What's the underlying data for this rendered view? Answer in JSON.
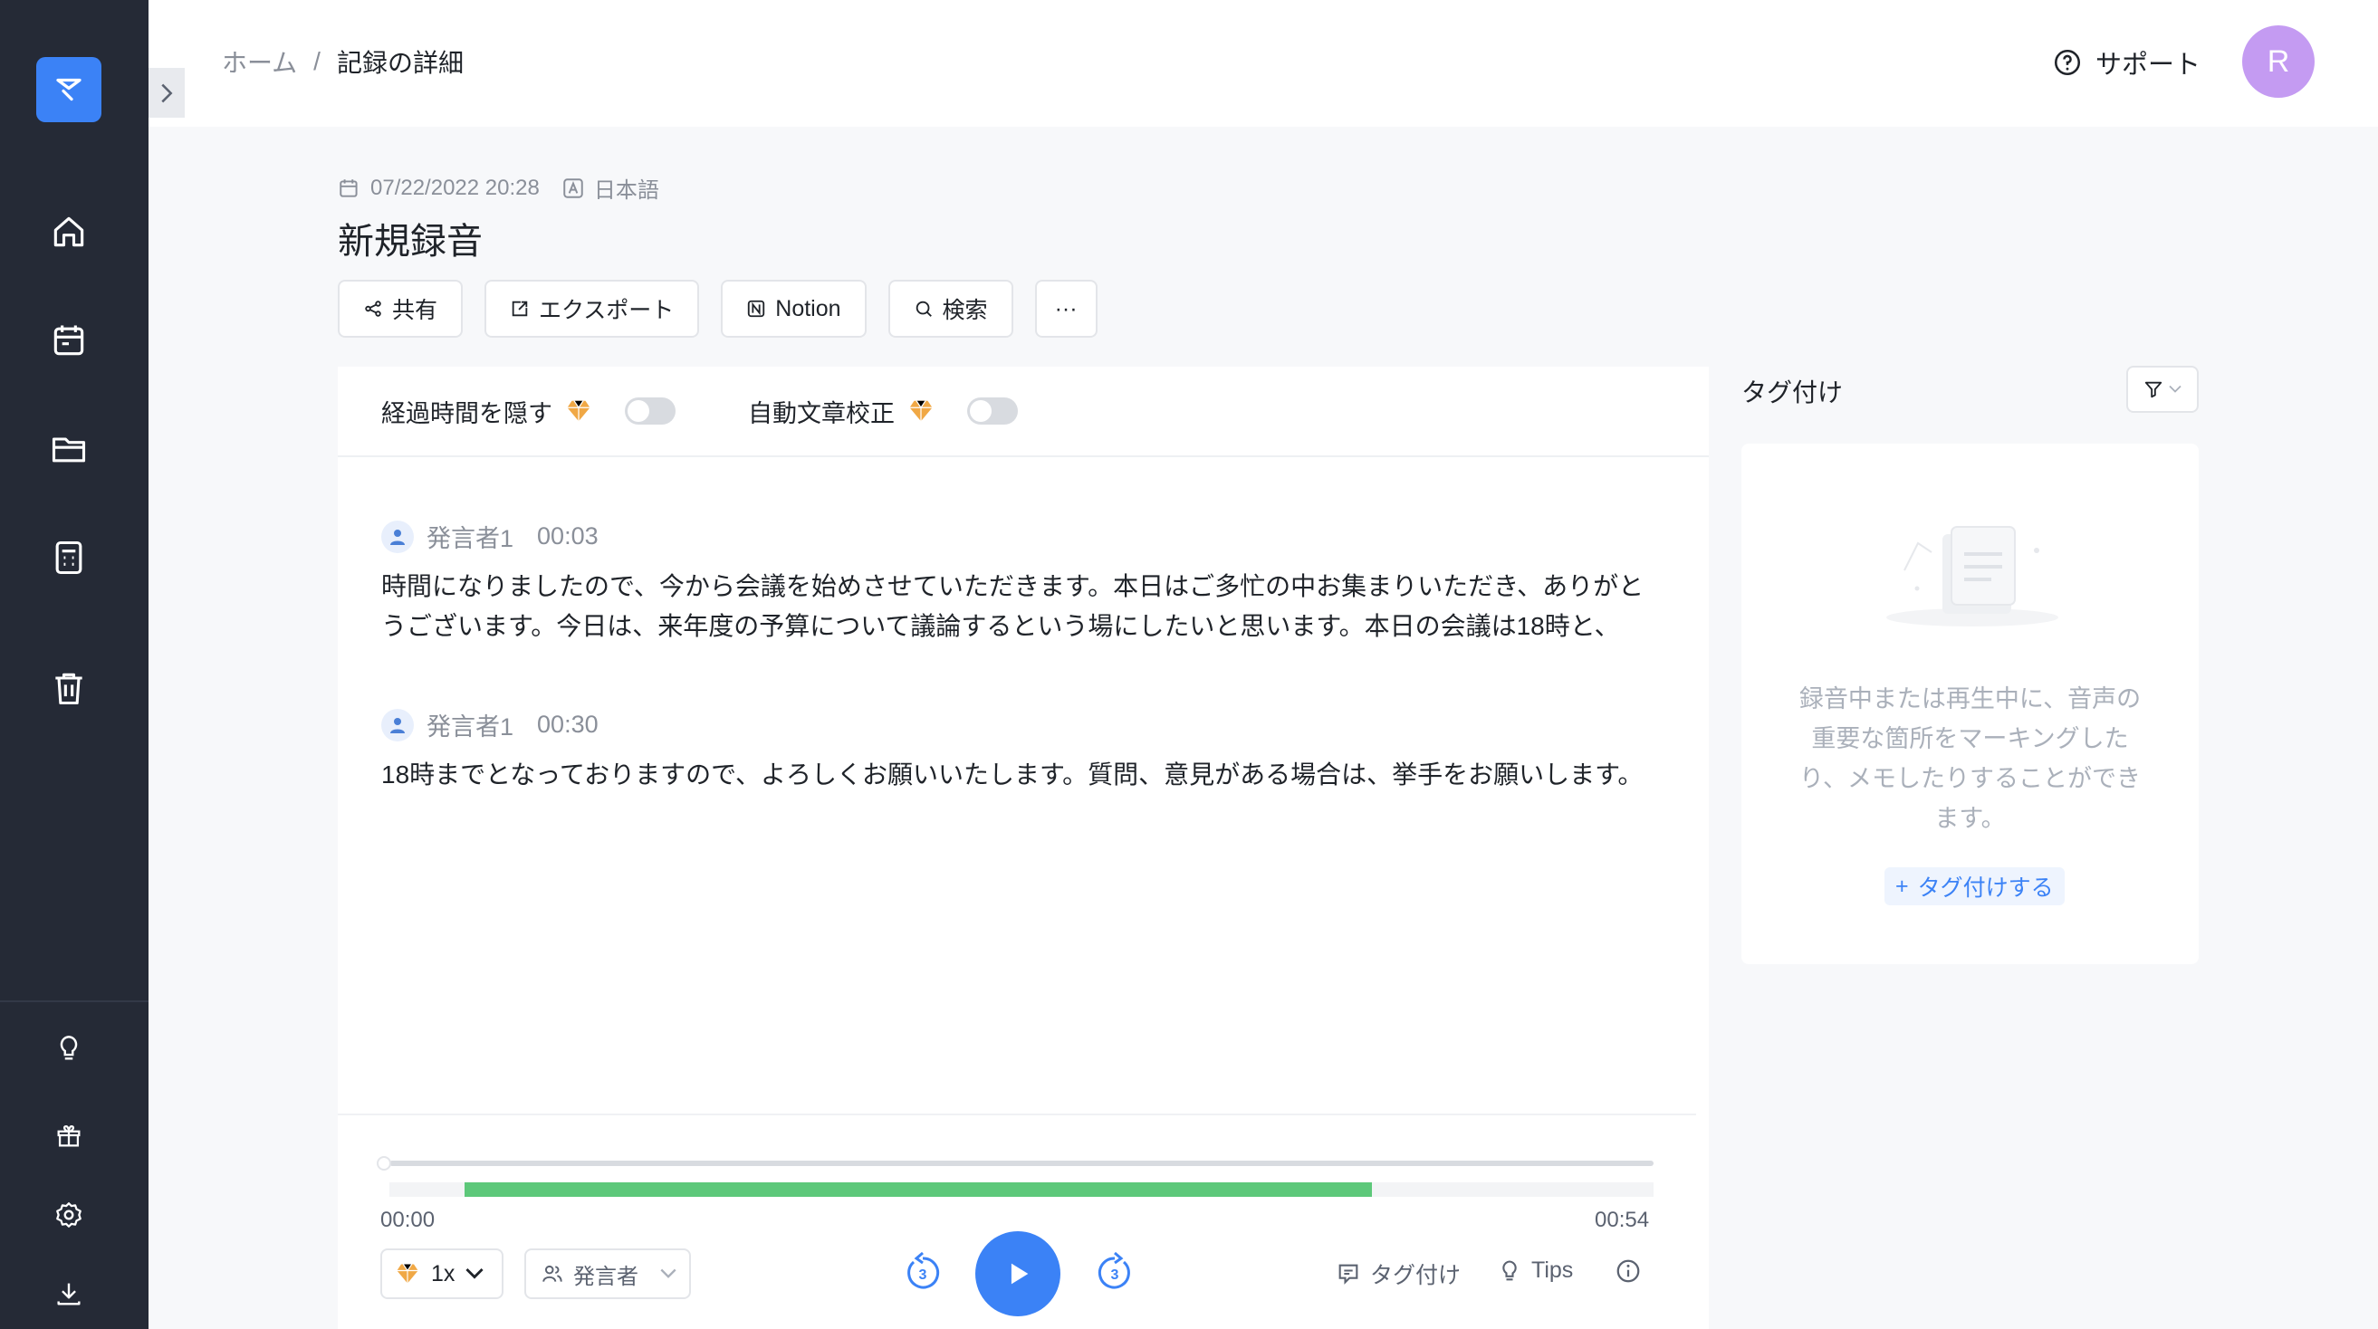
{
  "breadcrumb": {
    "home": "ホーム",
    "separator": "/",
    "current": "記録の詳細"
  },
  "header": {
    "support_label": "サポート",
    "avatar_initial": "R"
  },
  "record": {
    "datetime": "07/22/2022 20:28",
    "language": "日本語",
    "title": "新規録音"
  },
  "toolbar": {
    "share": "共有",
    "export": "エクスポート",
    "notion": "Notion",
    "search": "検索",
    "more": "···"
  },
  "options": {
    "hide_elapsed": "経過時間を隠す",
    "auto_proofread": "自動文章校正",
    "hide_elapsed_on": false,
    "auto_proofread_on": false
  },
  "segments": [
    {
      "speaker": "発言者1",
      "time": "00:03",
      "text": "時間になりましたので、今から会議を始めさせていただきます。本日はご多忙の中お集まりいただき、ありがとうございます。今日は、来年度の予算について議論するという場にしたいと思います。本日の会議は18時と、"
    },
    {
      "speaker": "発言者1",
      "time": "00:30",
      "text": "18時までとなっておりますので、よろしくお願いいたします。質問、意見がある場合は、挙手をお願いします。"
    }
  ],
  "player": {
    "current_time": "00:00",
    "total_time": "00:54",
    "speed": "1x",
    "speaker_filter": "発言者",
    "skip_back": "3",
    "skip_forward": "3",
    "tag_label": "タグ付け",
    "tips_label": "Tips",
    "progress_fraction": 0.0
  },
  "tagging": {
    "title": "タグ付け",
    "empty_text": "録音中または再生中に、音声の重要な箇所をマーキングしたり、メモしたりすることができます。",
    "add_label": "タグ付けする"
  },
  "colors": {
    "accent": "#3b82f6",
    "sidebar": "#252a36",
    "waveform": "#5dc87a",
    "premium": "#f0a845"
  }
}
